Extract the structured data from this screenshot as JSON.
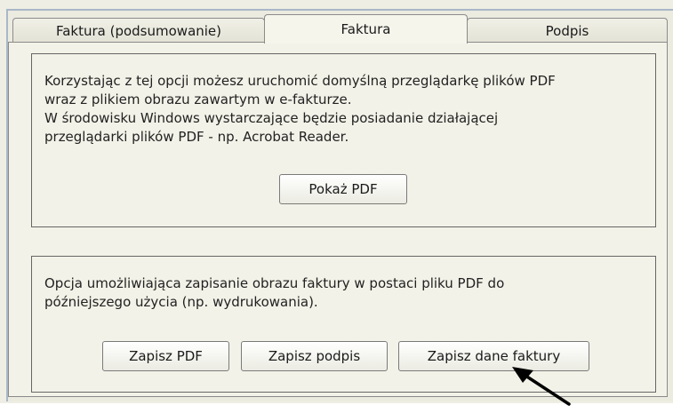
{
  "tabs": [
    {
      "label": "Faktura (podsumowanie)"
    },
    {
      "label": "Faktura"
    },
    {
      "label": "Podpis"
    }
  ],
  "section_pdf_view": {
    "lines": [
      "Korzystając z tej opcji możesz uruchomić domyślną przeglądarkę plików PDF",
      "wraz z plikiem obrazu zawartym w e-fakturze.",
      "W środowisku Windows wystarczające będzie posiadanie działającej",
      "przeglądarki plików PDF - np. Acrobat Reader."
    ],
    "button_label": "Pokaż PDF"
  },
  "section_pdf_save": {
    "lines": [
      "Opcja umożliwiająca zapisanie obrazu faktury w postaci pliku PDF do",
      "późniejszego użycia (np. wydrukowania)."
    ],
    "buttons": [
      {
        "label": "Zapisz PDF"
      },
      {
        "label": "Zapisz podpis"
      },
      {
        "label": "Zapisz dane faktury"
      }
    ]
  },
  "annotation": {
    "icon": "arrow-pointer-icon"
  }
}
